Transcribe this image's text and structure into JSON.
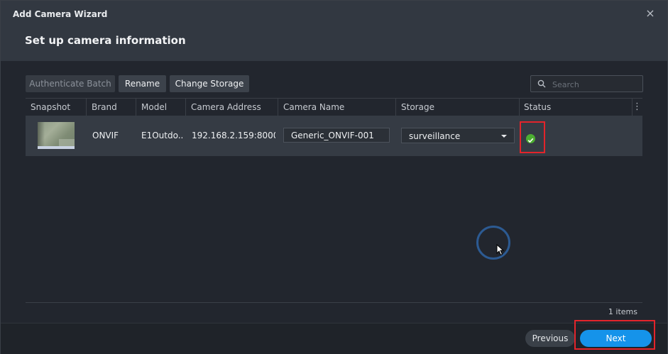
{
  "window": {
    "title": "Add Camera Wizard",
    "close_icon": "×",
    "step_title": "Set up camera information"
  },
  "toolbar": {
    "authenticate_batch": "Authenticate Batch",
    "rename": "Rename",
    "change_storage": "Change Storage",
    "search_placeholder": "Search"
  },
  "grid": {
    "columns": [
      "Snapshot",
      "Brand",
      "Model",
      "Camera Address",
      "Camera Name",
      "Storage",
      "Status"
    ],
    "rows": [
      {
        "brand": "ONVIF",
        "model": "E1Outdo...",
        "address": "192.168.2.159:8000",
        "camera_name": "Generic_ONVIF-001",
        "storage": "surveillance",
        "status": "ok"
      }
    ],
    "item_count": "1 items"
  },
  "footer": {
    "previous": "Previous",
    "next": "Next"
  },
  "colors": {
    "accent": "#1593ea",
    "status_ok": "#4cae31",
    "highlight": "#e3242b"
  }
}
